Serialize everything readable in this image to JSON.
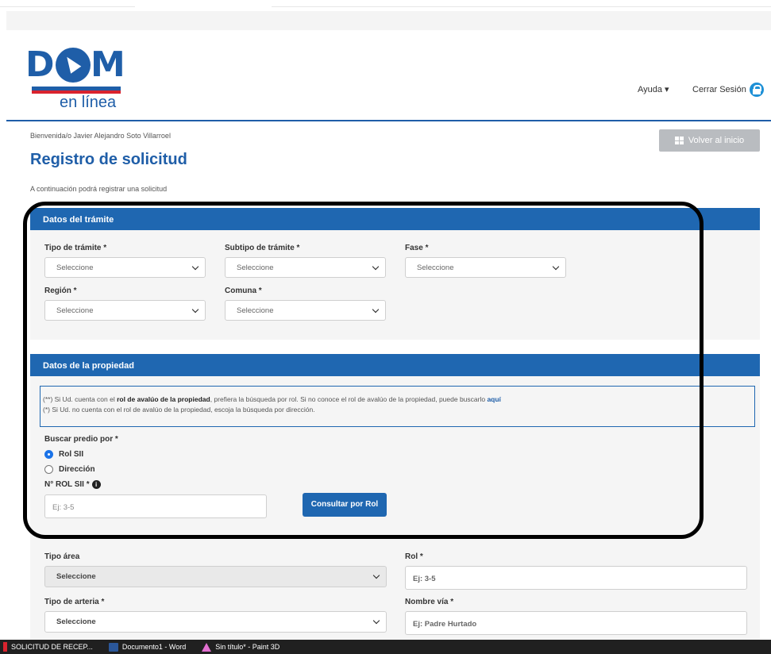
{
  "header": {
    "logo_text_d": "D",
    "logo_text_m": "M",
    "logo_subtext": "en línea",
    "help_label": "Ayuda ▾",
    "logout_label": "Cerrar Sesión"
  },
  "page": {
    "welcome": "Bienvenida/o Javier Alejandro Soto Villarroel",
    "back_button": "Volver al inicio",
    "title": "Registro de solicitud",
    "subtitle": "A continuación podrá registrar una solicitud"
  },
  "tramite": {
    "heading": "Datos del trámite",
    "tipo_label": "Tipo de trámite *",
    "tipo_value": "Seleccione",
    "subtipo_label": "Subtipo de trámite *",
    "subtipo_value": "Seleccione",
    "fase_label": "Fase *",
    "fase_value": "Seleccione",
    "region_label": "Región *",
    "region_value": "Seleccione",
    "comuna_label": "Comuna *",
    "comuna_value": "Seleccione"
  },
  "propiedad": {
    "heading": "Datos de la propiedad",
    "info_line1_a": "(**) Si Ud. cuenta con el ",
    "info_line1_b": "rol de avalúo de la propiedad",
    "info_line1_c": ", prefiera la búsqueda por rol. Si no conoce el rol de avalúo de la propiedad, puede buscarlo ",
    "info_line1_link": "aquí",
    "info_line2": "(*) Si Ud. no cuenta con el rol de avalúo de la propiedad, escoja la búsqueda por dirección.",
    "buscar_label": "Buscar predio por *",
    "option_rol": "Rol SII",
    "option_direccion": "Dirección",
    "selected_option": "Rol SII",
    "rol_label": "N° ROL SII *",
    "rol_placeholder": "Ej: 3-5",
    "consult_button": "Consultar por Rol",
    "tipo_area_label": "Tipo área",
    "tipo_area_value": "Seleccione",
    "rol2_label": "Rol *",
    "rol2_placeholder": "Ej: 3-5",
    "tipo_arteria_label": "Tipo de arteria *",
    "tipo_arteria_value": "Seleccione",
    "nombre_via_label": "Nombre vía *",
    "nombre_via_placeholder": "Ej: Padre Hurtado"
  },
  "taskbar": {
    "items": [
      "SOLICITUD DE RECEP...",
      "Documento1 - Word",
      "Sin título* - Paint 3D"
    ]
  },
  "colors": {
    "primary": "#1f5ea8",
    "panel_header": "#1f67b1",
    "accent_red": "#d9232e",
    "disabled_button": "#b9bcc0"
  }
}
